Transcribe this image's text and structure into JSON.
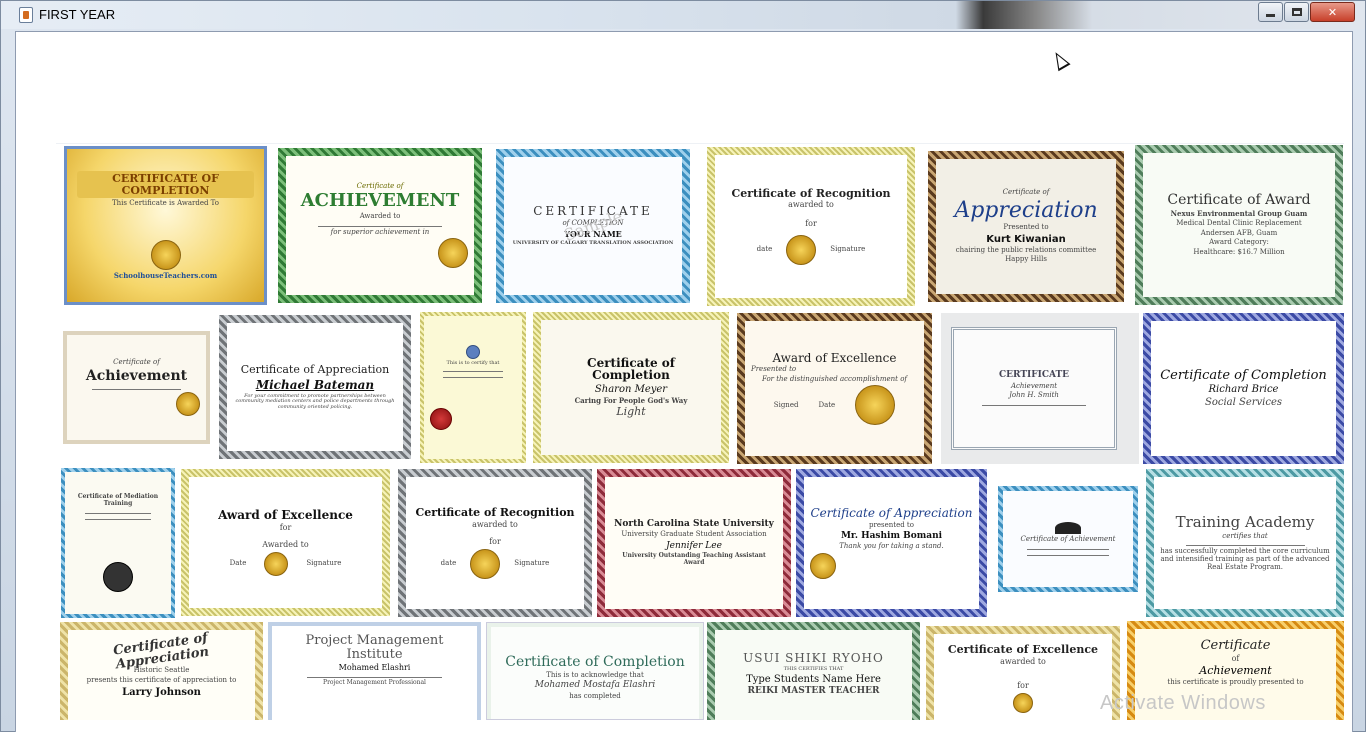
{
  "window": {
    "title": "FIRST YEAR",
    "close_label": "✕",
    "accent_close": "#c7402a"
  },
  "os_watermark": "Activate Windows",
  "certificates": [
    {
      "id": "c1",
      "title": "CERTIFICATE OF COMPLETION",
      "line1": "This Certificate is Awarded To",
      "name": "",
      "footer": "SchoolhouseTeachers.com"
    },
    {
      "id": "c2",
      "title": "ACHIEVEMENT",
      "line1": "Certificate of",
      "line2": "Awarded to",
      "line3": "for superior achievement in"
    },
    {
      "id": "c3",
      "title": "CERTIFICATE",
      "line1": "of COMPLETION",
      "name": "YOUR NAME",
      "line2": "UNIVERSITY OF CALGARY TRANSLATION ASSOCIATION",
      "stamp": "Sample"
    },
    {
      "id": "c4",
      "title": "Certificate of Recognition",
      "line1": "awarded to",
      "line2": "for",
      "sig1": "date",
      "sig2": "Signature"
    },
    {
      "id": "c5",
      "title": "Appreciation",
      "line1": "Certificate of",
      "line2": "Presented to",
      "name": "Kurt Kiwanian",
      "line3": "chairing the public relations committee",
      "line4": "Happy Hills"
    },
    {
      "id": "c6",
      "title": "Certificate of Award",
      "line1": "Nexus Environmental Group Guam",
      "line2": "Medical Dental Clinic Replacement",
      "line3": "Andersen AFB, Guam",
      "line4": "Award Category:",
      "line5": "Healthcare: $16.7 Million"
    },
    {
      "id": "c7",
      "title": "Achievement",
      "line1": "Certificate of"
    },
    {
      "id": "c8",
      "title": "Certificate of Appreciation",
      "name": "Michael Bateman",
      "line1": "For your commitment to promote partnerships between community mediation centers and police departments through community oriented policing."
    },
    {
      "id": "c9",
      "title": "",
      "line1": "This is to certify that"
    },
    {
      "id": "c10",
      "title": "Certificate of Completion",
      "name": "Sharon Meyer",
      "line1": "Caring For People God's Way",
      "line2": "Light"
    },
    {
      "id": "c11",
      "title": "Award of Excellence",
      "line1": "Presented to",
      "line2": "For the distinguished accomplishment of",
      "sig1": "Signed",
      "sig2": "Date"
    },
    {
      "id": "c12",
      "title": "CERTIFICATE",
      "line1": "Achievement",
      "name": "John H. Smith"
    },
    {
      "id": "c13",
      "title": "Certificate of Completion",
      "name": "Richard Brice",
      "line1": "Social Services"
    },
    {
      "id": "c14",
      "title": "Certificate of Mediation Training"
    },
    {
      "id": "c15",
      "title": "Award of Excellence",
      "line1": "for",
      "line2": "Awarded to",
      "sig1": "Date",
      "sig2": "Signature"
    },
    {
      "id": "c16",
      "title": "Certificate of Recognition",
      "line1": "awarded to",
      "line2": "for",
      "sig1": "date",
      "sig2": "Signature"
    },
    {
      "id": "c17",
      "title": "North Carolina State University",
      "line1": "University Graduate Student Association",
      "name": "Jennifer Lee",
      "line2": "University Outstanding Teaching Assistant Award"
    },
    {
      "id": "c18",
      "title": "Certificate of Appreciation",
      "line1": "presented to",
      "name": "Mr. Hashim Bomani",
      "line2": "Thank you for taking a stand."
    },
    {
      "id": "c19",
      "title": "Certificate of Achievement"
    },
    {
      "id": "c20",
      "title": "Training Academy",
      "line1": "certifies that",
      "line2": "has successfully completed the core curriculum and intensified training as part of the advanced Real Estate Program."
    },
    {
      "id": "c21",
      "title": "Certificate of Appreciation",
      "line1": "Historic Seattle",
      "line2": "presents this certificate of appreciation to",
      "name": "Larry Johnson"
    },
    {
      "id": "c22",
      "title": "Project Management Institute",
      "name": "Mohamed Elashri",
      "line1": "Project Management Professional"
    },
    {
      "id": "c23",
      "title": "Certificate of Completion",
      "line1": "This is to acknowledge that",
      "name": "Mohamed Mostafa Elashri",
      "line2": "has completed"
    },
    {
      "id": "c24",
      "title": "USUI SHIKI RYOHO",
      "line1": "THIS CERTIFIES THAT",
      "name": "Type Students Name Here",
      "line2": "REIKI MASTER TEACHER"
    },
    {
      "id": "c25",
      "title": "Certificate of Excellence",
      "line1": "awarded to",
      "line2": "for"
    },
    {
      "id": "c26",
      "title": "Certificate",
      "line1": "of",
      "line2": "Achievement",
      "line3": "this certificate is proudly presented to"
    }
  ]
}
